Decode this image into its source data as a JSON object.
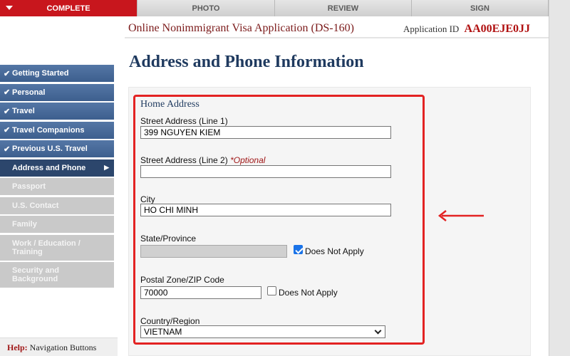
{
  "tabs": [
    {
      "label": "COMPLETE",
      "active": true
    },
    {
      "label": "PHOTO",
      "active": false
    },
    {
      "label": "REVIEW",
      "active": false
    },
    {
      "label": "SIGN",
      "active": false
    }
  ],
  "header": {
    "app_title": "Online Nonimmigrant Visa Application (DS-160)",
    "app_id_label": "Application ID",
    "app_id_value": "AA00EJE0JJ"
  },
  "page_title": "Address and Phone Information",
  "sidebar": {
    "items": [
      {
        "label": "Getting Started",
        "state": "done"
      },
      {
        "label": "Personal",
        "state": "done"
      },
      {
        "label": "Travel",
        "state": "done"
      },
      {
        "label": "Travel Companions",
        "state": "done"
      },
      {
        "label": "Previous U.S. Travel",
        "state": "done"
      },
      {
        "label": "Address and Phone",
        "state": "current"
      },
      {
        "label": "Passport",
        "state": "todo"
      },
      {
        "label": "U.S. Contact",
        "state": "todo"
      },
      {
        "label": "Family",
        "state": "todo"
      },
      {
        "label": "Work / Education / Training",
        "state": "todo"
      },
      {
        "label": "Security and Background",
        "state": "todo"
      }
    ],
    "check_glyph": "✔",
    "current_arrow_glyph": "▶"
  },
  "help": {
    "label": "Help:",
    "text": "Navigation Buttons"
  },
  "form": {
    "section_title": "Home Address",
    "street1": {
      "label": "Street Address (Line 1)",
      "value": "399 NGUYEN KIEM"
    },
    "street2": {
      "label": "Street Address (Line 2)",
      "optional": "*Optional",
      "value": ""
    },
    "city": {
      "label": "City",
      "value": "HO CHI MINH"
    },
    "state": {
      "label": "State/Province",
      "value": "",
      "does_not_apply_label": "Does Not Apply",
      "does_not_apply_checked": true
    },
    "postal": {
      "label": "Postal Zone/ZIP Code",
      "value": "70000",
      "does_not_apply_label": "Does Not Apply",
      "does_not_apply_checked": false
    },
    "country": {
      "label": "Country/Region",
      "value": "VIETNAM"
    }
  },
  "colors": {
    "accent_red": "#e32323",
    "nav_blue": "#3d5f8e",
    "nav_current": "#2c466c",
    "title_blue": "#1f3a5f"
  }
}
